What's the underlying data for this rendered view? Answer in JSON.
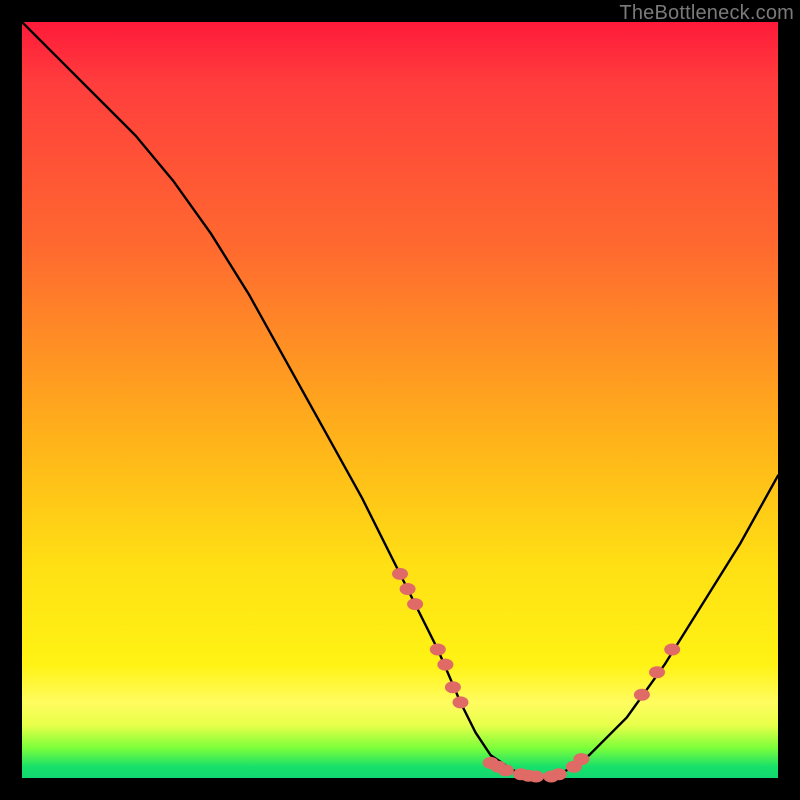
{
  "watermark": "TheBottleneck.com",
  "chart_data": {
    "type": "line",
    "title": "",
    "xlabel": "",
    "ylabel": "",
    "xlim": [
      0,
      100
    ],
    "ylim": [
      0,
      100
    ],
    "grid": false,
    "legend": false,
    "series": [
      {
        "name": "bottleneck-curve",
        "color": "#000000",
        "x": [
          0,
          5,
          10,
          15,
          20,
          25,
          30,
          35,
          40,
          45,
          50,
          55,
          58,
          60,
          62,
          65,
          68,
          70,
          72,
          75,
          80,
          85,
          90,
          95,
          100
        ],
        "y": [
          100,
          95,
          90,
          85,
          79,
          72,
          64,
          55,
          46,
          37,
          27,
          17,
          10,
          6,
          3,
          1,
          0,
          0,
          1,
          3,
          8,
          15,
          23,
          31,
          40
        ]
      }
    ],
    "markers": {
      "name": "highlight-dots",
      "color": "#e06a66",
      "points": [
        {
          "x": 50,
          "y": 27
        },
        {
          "x": 51,
          "y": 25
        },
        {
          "x": 52,
          "y": 23
        },
        {
          "x": 55,
          "y": 17
        },
        {
          "x": 56,
          "y": 15
        },
        {
          "x": 57,
          "y": 12
        },
        {
          "x": 58,
          "y": 10
        },
        {
          "x": 62,
          "y": 2
        },
        {
          "x": 63,
          "y": 1.5
        },
        {
          "x": 64,
          "y": 1
        },
        {
          "x": 66,
          "y": 0.5
        },
        {
          "x": 67,
          "y": 0.3
        },
        {
          "x": 68,
          "y": 0.2
        },
        {
          "x": 70,
          "y": 0.2
        },
        {
          "x": 71,
          "y": 0.5
        },
        {
          "x": 73,
          "y": 1.5
        },
        {
          "x": 74,
          "y": 2.5
        },
        {
          "x": 82,
          "y": 11
        },
        {
          "x": 84,
          "y": 14
        },
        {
          "x": 86,
          "y": 17
        }
      ]
    }
  }
}
